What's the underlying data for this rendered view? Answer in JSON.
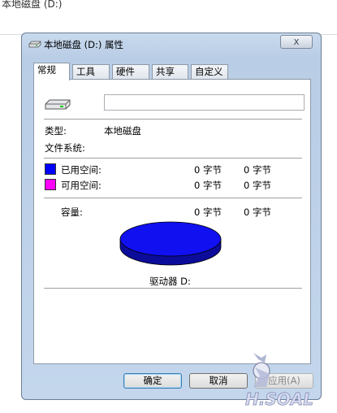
{
  "background": {
    "title": "本地磁盘 (D:)"
  },
  "window": {
    "title": "本地磁盘 (D:) 属性",
    "close_label": "x"
  },
  "tabs": [
    {
      "label": "常规",
      "active": true
    },
    {
      "label": "工具",
      "active": false
    },
    {
      "label": "硬件",
      "active": false
    },
    {
      "label": "共享",
      "active": false
    },
    {
      "label": "自定义",
      "active": false
    }
  ],
  "general": {
    "volume_label_value": "",
    "type_label": "类型:",
    "type_value": "本地磁盘",
    "filesystem_label": "文件系统:",
    "filesystem_value": "",
    "used_label": "已用空间:",
    "used_bytes": "0 字节",
    "used_size": "0 字节",
    "free_label": "可用空间:",
    "free_bytes": "0 字节",
    "free_size": "0 字节",
    "capacity_label": "容量:",
    "capacity_bytes": "0 字节",
    "capacity_size": "0 字节",
    "drive_label": "驱动器 D:",
    "used_fraction": 1.0
  },
  "buttons": {
    "ok": "确定",
    "cancel": "取消",
    "apply": "应用(A)"
  },
  "colors": {
    "used": "#0000ff",
    "free": "#ff00ff",
    "pie_top": "#1010f0",
    "pie_side": "#0c0c9a"
  },
  "icons": {
    "title_icon": "drive-icon",
    "drive_icon": "hard-drive-icon",
    "watermark": "mascot-watermark"
  },
  "watermark_text": "H.SOAL"
}
